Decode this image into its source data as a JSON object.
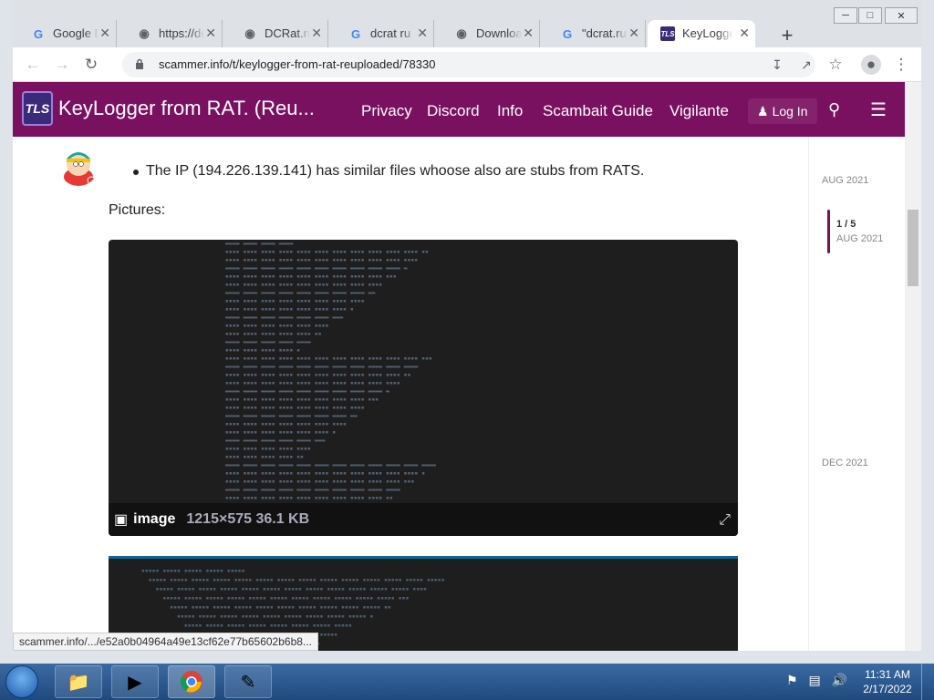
{
  "browser": {
    "tabs": [
      {
        "label": "Google D",
        "icon": "google-icon"
      },
      {
        "label": "https://dc",
        "icon": "globe-icon"
      },
      {
        "label": "DCRat.ru",
        "icon": "globe-icon"
      },
      {
        "label": "dcrat ru",
        "icon": "google-icon"
      },
      {
        "label": "Download",
        "icon": "globe-icon"
      },
      {
        "label": "\"dcrat.ru\"",
        "icon": "google-icon"
      },
      {
        "label": "KeyLogge",
        "icon": "tls-icon",
        "active": true
      }
    ],
    "url": "scammer.info/t/keylogger-from-rat-reuploaded/78330",
    "status_url": "scammer.info/.../e52a0b04964a49e13cf62e77b65602b6b8..."
  },
  "site": {
    "logo_text": "TLS",
    "title": "KeyLogger from RAT. (Reu...",
    "nav": [
      "Privacy",
      "Discord",
      "Info",
      "Scambait Guide",
      "Vigilante"
    ],
    "login_label": "Log In"
  },
  "post": {
    "bullet": "The IP (194.226.139.141) has similar files whoose also are stubs from RATS.",
    "pictures_label": "Pictures:",
    "image1": {
      "name": "image",
      "dims": "1215×575 36.1 KB"
    }
  },
  "timeline": {
    "top_date": "AUG 2021",
    "position": "1 / 5",
    "current_date": "AUG 2021",
    "bottom_date": "DEC 2021"
  },
  "taskbar": {
    "time": "11:31 AM",
    "date": "2/17/2022"
  }
}
